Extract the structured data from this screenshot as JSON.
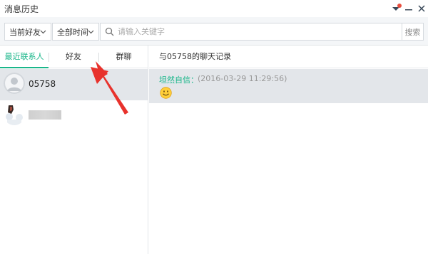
{
  "window": {
    "title": "消息历史",
    "controls": {
      "dropdown_icon": "dropdown-icon",
      "minimize_icon": "minimize-icon",
      "close_icon": "close-icon",
      "notify_color": "#e84d3d"
    }
  },
  "toolbar": {
    "friend_filter": "当前好友",
    "time_filter": "全部时间",
    "search_placeholder": "请输入关键字",
    "search_button": "搜索"
  },
  "tabs": [
    {
      "label": "最近联系人",
      "active": true
    },
    {
      "label": "好友",
      "active": false
    },
    {
      "label": "群聊",
      "active": false
    }
  ],
  "contacts": [
    {
      "name": "05758",
      "selected": true
    },
    {
      "name": "",
      "selected": false,
      "blurred": true
    }
  ],
  "chat": {
    "header": "与05758的聊天记录",
    "messages": [
      {
        "sender": "坦然自信：",
        "time": "(2016-03-29 11:29:56)",
        "content_icon": "smile-emoji-icon"
      }
    ]
  },
  "colors": {
    "accent": "#19b68a",
    "annotation_arrow": "#e8322c"
  }
}
